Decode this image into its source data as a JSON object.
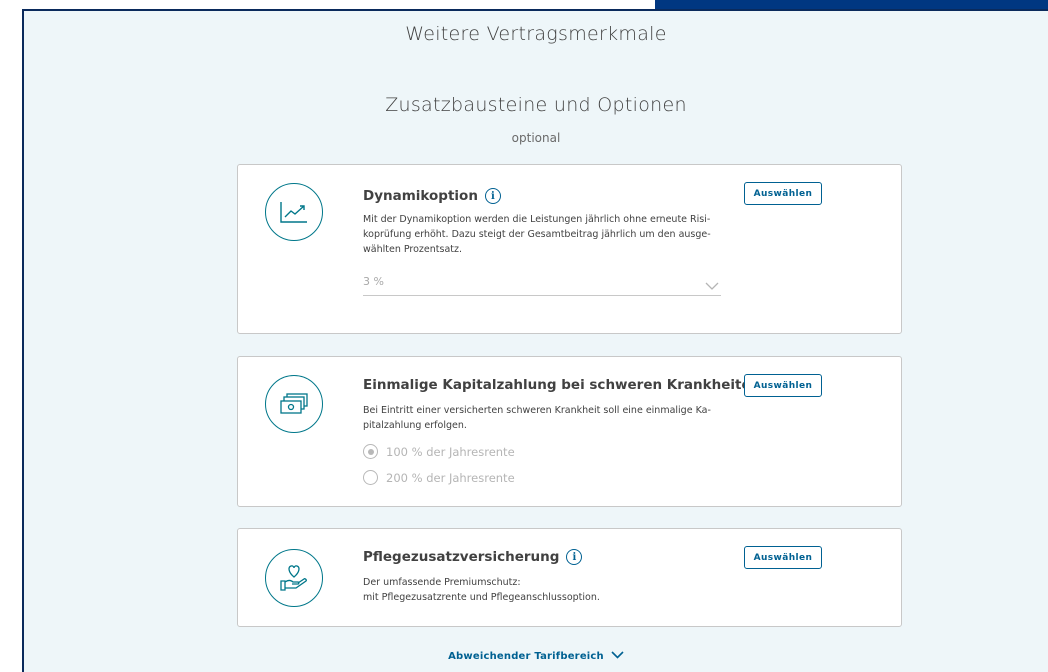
{
  "header": {
    "section_title": "Weitere Vertragsmerkmale"
  },
  "addons": {
    "title": "Zusatzbausteine und Optionen",
    "subtitle": "optional"
  },
  "cards": [
    {
      "title": "Dynamikoption",
      "description": "Mit der Dynamikoption werden die Leistungen jährlich ohne erneute Risi-koprüfung erhöht. Dazu steigt der Gesamtbeitrag jährlich um den ausge-wählten Prozentsatz.",
      "description_lines": [
        "Mit der Dynamikoption werden die Leistungen jährlich ohne erneute Risi-",
        "koprüfung erhöht. Dazu steigt der Gesamtbeitrag jährlich um den ausge-",
        "wählten Prozentsatz."
      ],
      "button_label": "Auswählen",
      "icon": "chart-trend-up-icon",
      "dropdown_value": "3 %"
    },
    {
      "title": "Einmalige Kapitalzahlung bei schweren Krankheiten",
      "description_lines": [
        "Bei Eintritt einer versicherten schweren Krankheit soll eine einmalige Ka-",
        "pitalzahlung erfolgen."
      ],
      "button_label": "Auswählen",
      "icon": "money-stack-icon",
      "options": [
        {
          "label": "100 % der Jahresrente",
          "selected": true
        },
        {
          "label": "200 % der Jahresrente",
          "selected": false
        }
      ]
    },
    {
      "title": "Pflegezusatzversicherung",
      "description_lines": [
        "Der umfassende Premiumschutz:",
        "mit Pflegezusatzrente und Pflegeanschlussoption."
      ],
      "button_label": "Auswählen",
      "icon": "heart-in-hand-icon"
    }
  ],
  "footer": {
    "link_label": "Abweichender Tarifbereich"
  },
  "colors": {
    "brand_dark": "#003781",
    "accent": "#006192",
    "icon_teal": "#00778a",
    "background": "#eef6f9"
  }
}
